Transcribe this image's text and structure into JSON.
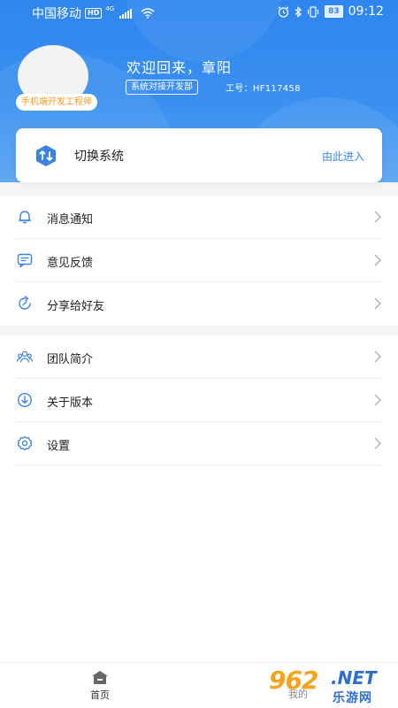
{
  "status_bar": {
    "carrier": "中国移动",
    "hd": "HD",
    "network": "4G",
    "battery": "83",
    "time": "09:12"
  },
  "profile": {
    "role_badge": "手机端开发工程师",
    "welcome": "欢迎回来，章阳",
    "department": "系统对接开发部",
    "employee_id": "工号：HF117458"
  },
  "switch_card": {
    "label": "切换系统",
    "enter_link": "由此进入",
    "icon": "switch-arrows-icon",
    "icon_color": "#3b84e0"
  },
  "menu_group_1": [
    {
      "label": "消息通知",
      "icon": "bell-icon"
    },
    {
      "label": "意见反馈",
      "icon": "feedback-icon"
    },
    {
      "label": "分享给好友",
      "icon": "share-icon"
    }
  ],
  "menu_group_2": [
    {
      "label": "团队简介",
      "icon": "team-icon"
    },
    {
      "label": "关于版本",
      "icon": "download-icon"
    },
    {
      "label": "设置",
      "icon": "gear-icon"
    }
  ],
  "tabbar": {
    "home": "首页",
    "mine": "我的"
  },
  "watermark": {
    "brand": "962",
    "tld": ".NET",
    "sub": "乐游网"
  },
  "colors": {
    "header_blue": "#2f86ee",
    "accent_blue": "#3a86e8",
    "badge_orange": "#f29b1e",
    "icon_blue": "#3b84e0"
  }
}
